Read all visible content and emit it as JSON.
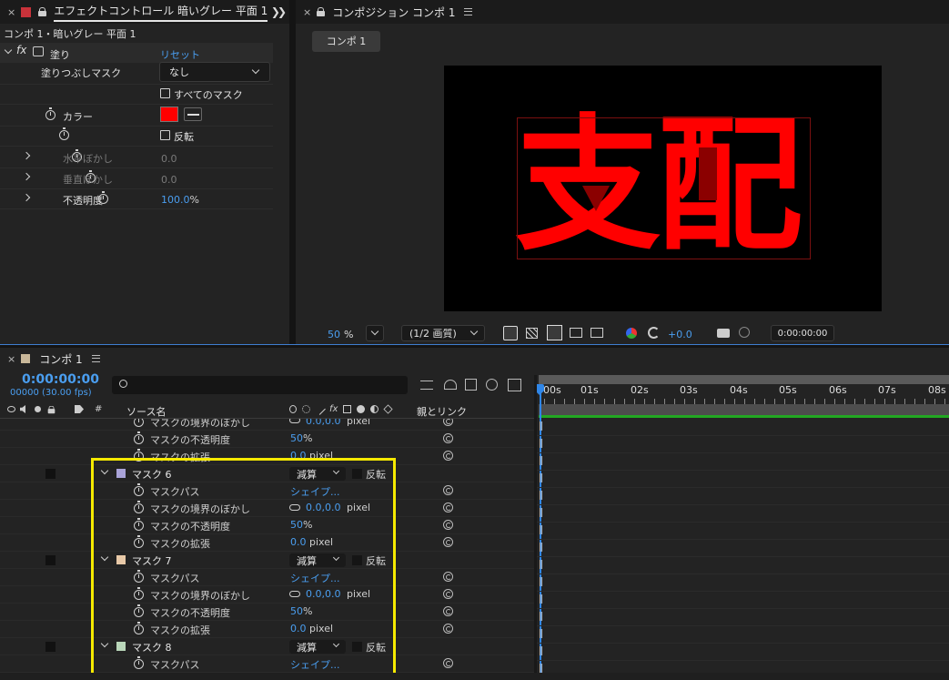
{
  "effect_panel": {
    "tab_title": "エフェクトコントロール 暗いグレー 平面 1",
    "breadcrumb": "コンポ 1・暗いグレー 平面 1",
    "effect_name": "塗り",
    "reset_label": "リセット",
    "props": {
      "fill_mask_label": "塗りつぶしマスク",
      "fill_mask_value": "なし",
      "all_masks_label": "すべてのマスク",
      "color_label": "カラー",
      "color_value": "#ff0000",
      "invert_label": "反転",
      "h_blur_label": "水平ぼかし",
      "h_blur_value": "0.0",
      "v_blur_label": "垂直ぼかし",
      "v_blur_value": "0.0",
      "opacity_label": "不透明度",
      "opacity_value": "100.0",
      "opacity_unit": "%"
    }
  },
  "comp_panel": {
    "tab_title": "コンポジション コンポ 1",
    "comp_tab": "コンポ 1",
    "canvas_text": "支配",
    "zoom_value": "50",
    "zoom_unit": "%",
    "resolution": "(1/2 画質)",
    "exposure": "+0.0",
    "timecode": "0:00:00:00"
  },
  "timeline": {
    "tab_title": "コンポ 1",
    "timecode": "0:00:00:00",
    "frames": "00000 (30.00 fps)",
    "search_placeholder": "",
    "source_name_header": "ソース名",
    "parent_link_header": "親とリンク",
    "ruler": [
      "00s",
      "01s",
      "02s",
      "03s",
      "04s",
      "05s",
      "06s",
      "07s",
      "08s"
    ],
    "partial_rows": [
      {
        "label": "マスクの境界のぼかし",
        "value": "0.0,0.0",
        "unit": "pixel"
      },
      {
        "label": "マスクの不透明度",
        "value": "50",
        "unit": "%"
      },
      {
        "label": "マスクの拡張",
        "value": "0.0",
        "unit": "pixel"
      }
    ],
    "masks": [
      {
        "name": "マスク 6",
        "color": "#a9a3d8",
        "mode": "減算",
        "invert_label": "反転",
        "path_label": "マスクパス",
        "path_value": "シェイプ...",
        "feather_label": "マスクの境界のぼかし",
        "feather_value": "0.0,0.0",
        "feather_unit": "pixel",
        "opacity_label": "マスクの不透明度",
        "opacity_value": "50",
        "opacity_unit": "%",
        "expansion_label": "マスクの拡張",
        "expansion_value": "0.0",
        "expansion_unit": "pixel"
      },
      {
        "name": "マスク 7",
        "color": "#e8c9a8",
        "mode": "減算",
        "invert_label": "反転",
        "path_label": "マスクパス",
        "path_value": "シェイプ...",
        "feather_label": "マスクの境界のぼかし",
        "feather_value": "0.0,0.0",
        "feather_unit": "pixel",
        "opacity_label": "マスクの不透明度",
        "opacity_value": "50",
        "opacity_unit": "%",
        "expansion_label": "マスクの拡張",
        "expansion_value": "0.0",
        "expansion_unit": "pixel"
      },
      {
        "name": "マスク 8",
        "color": "#b9d6b9",
        "mode": "減算",
        "invert_label": "反転",
        "path_label": "マスクパス",
        "path_value": "シェイプ..."
      }
    ]
  },
  "colors": {
    "accent_blue": "#4a9ef0",
    "highlight": "#f5e900",
    "playhead": "#2f86e8",
    "layer_bar": "#22a722"
  }
}
